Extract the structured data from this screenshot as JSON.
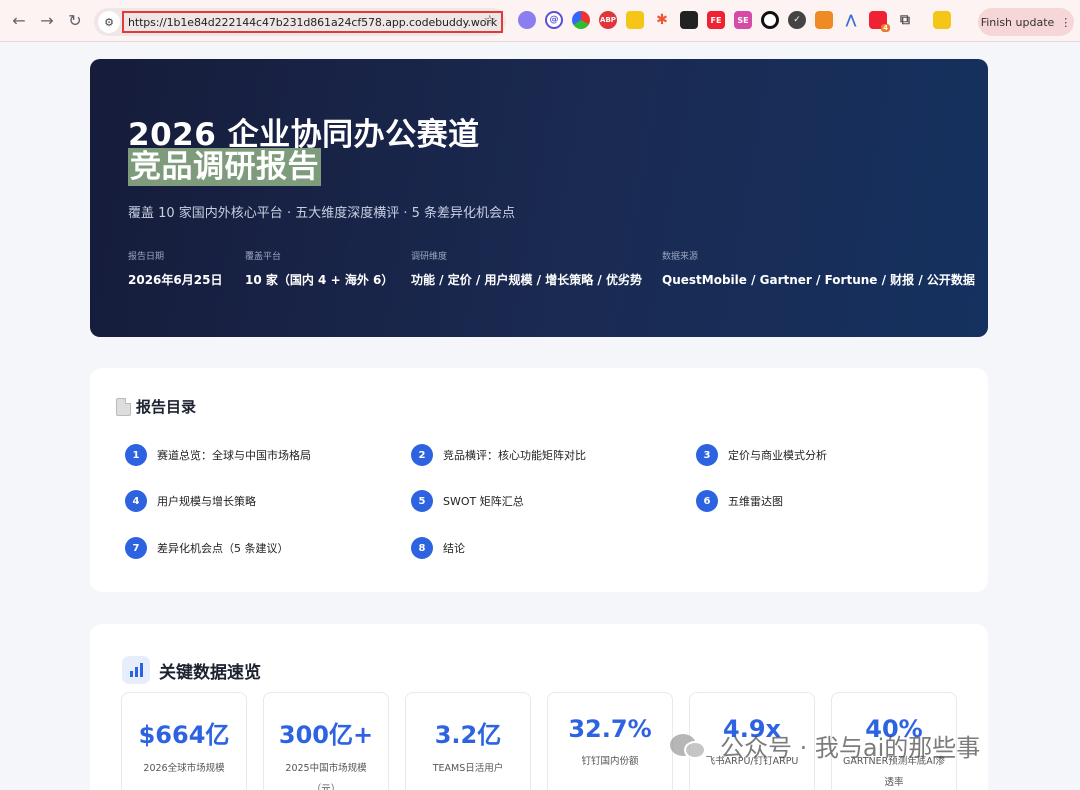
{
  "browser": {
    "url": "https://1b1e84d222144c47b231d861a24cf578.app.codebuddy.work",
    "finish_update": "Finish update",
    "extensions": [
      "ABP",
      "FE",
      "SE",
      "4"
    ]
  },
  "hero": {
    "title_line1": "2026 企业协同办公赛道",
    "title_line2": "竞品调研报告",
    "subtitle": "覆盖 10 家国内外核心平台 · 五大维度深度横评 · 5 条差异化机会点",
    "meta": [
      {
        "label": "报告日期",
        "value": "2026年6月25日"
      },
      {
        "label": "覆盖平台",
        "value": "10 家（国内 4 + 海外 6）"
      },
      {
        "label": "调研维度",
        "value": "功能 / 定价 / 用户规模 / 增长策略 / 优劣势"
      },
      {
        "label": "数据来源",
        "value": "QuestMobile / Gartner / Fortune / 财报 / 公开数据"
      }
    ]
  },
  "toc": {
    "title": "报告目录",
    "items": [
      {
        "num": "1",
        "label": "赛道总览：全球与中国市场格局"
      },
      {
        "num": "2",
        "label": "竞品横评：核心功能矩阵对比"
      },
      {
        "num": "3",
        "label": "定价与商业模式分析"
      },
      {
        "num": "4",
        "label": "用户规模与增长策略"
      },
      {
        "num": "5",
        "label": "SWOT 矩阵汇总"
      },
      {
        "num": "6",
        "label": "五维雷达图"
      },
      {
        "num": "7",
        "label": "差异化机会点（5 条建议）"
      },
      {
        "num": "8",
        "label": "结论"
      }
    ]
  },
  "stats": {
    "title": "关键数据速览",
    "items": [
      {
        "value": "$664亿",
        "label": "2026全球市场规模"
      },
      {
        "value": "300亿+",
        "label": "2025中国市场规模（元）"
      },
      {
        "value": "3.2亿",
        "label": "TEAMS日活用户"
      },
      {
        "value": "32.7%",
        "label": "钉钉国内份额"
      },
      {
        "value": "4.9x",
        "label": "飞书ARPU/钉钉ARPU"
      },
      {
        "value": "40%",
        "label": "GARTNER预测年底AI渗透率"
      }
    ]
  },
  "watermark": {
    "text": "公众号 · 我与ai的那些事"
  }
}
